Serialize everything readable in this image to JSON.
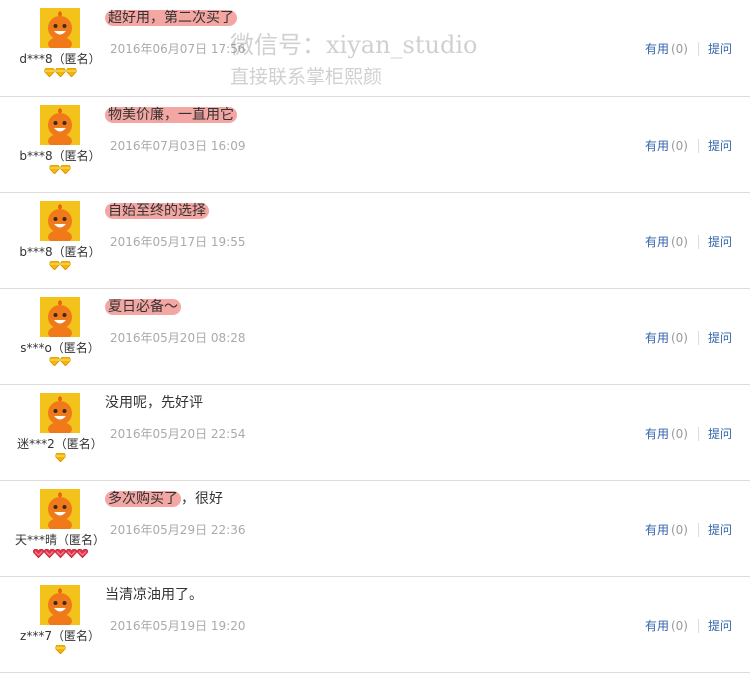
{
  "colors": {
    "highlight": "#f3a6a2",
    "link": "#3366aa",
    "date": "#aaaaaa",
    "divider": "#dddddd",
    "avatar_bg": "#f3c21b"
  },
  "watermark": {
    "line1": "微信号：xiyan_studio",
    "line2": "直接联系掌柜熙颜"
  },
  "reviews": [
    {
      "nick": "d***8（匿名）",
      "gems": 3,
      "gem_type": "gold-diamond",
      "text": "超好用，第二次买了",
      "text_tail": "",
      "highlighted": true,
      "date": "2016年06月07日 17:56",
      "useful_label": "有用",
      "useful_count": "(0)",
      "ask_label": "提问"
    },
    {
      "nick": "b***8（匿名）",
      "gems": 2,
      "gem_type": "gold-diamond",
      "text": "物美价廉，一直用它",
      "text_tail": "",
      "highlighted": true,
      "date": "2016年07月03日 16:09",
      "useful_label": "有用",
      "useful_count": "(0)",
      "ask_label": "提问"
    },
    {
      "nick": "b***8（匿名）",
      "gems": 2,
      "gem_type": "gold-diamond",
      "text": "自始至终的选择",
      "text_tail": "",
      "highlighted": true,
      "date": "2016年05月17日 19:55",
      "useful_label": "有用",
      "useful_count": "(0)",
      "ask_label": "提问"
    },
    {
      "nick": "s***o（匿名）",
      "gems": 2,
      "gem_type": "gold-diamond",
      "text": "夏日必备～",
      "text_tail": "",
      "highlighted": true,
      "date": "2016年05月20日 08:28",
      "useful_label": "有用",
      "useful_count": "(0)",
      "ask_label": "提问"
    },
    {
      "nick": "迷***2（匿名）",
      "gems": 1,
      "gem_type": "gold-diamond",
      "text": "没用呢，先好评",
      "text_tail": "",
      "highlighted": false,
      "date": "2016年05月20日 22:54",
      "useful_label": "有用",
      "useful_count": "(0)",
      "ask_label": "提问"
    },
    {
      "nick": "天***晴（匿名）",
      "gems": 5,
      "gem_type": "red-heart",
      "text": "多次购买了",
      "text_tail": "，很好",
      "highlighted": true,
      "date": "2016年05月29日 22:36",
      "useful_label": "有用",
      "useful_count": "(0)",
      "ask_label": "提问"
    },
    {
      "nick": "z***7（匿名）",
      "gems": 1,
      "gem_type": "gold-diamond",
      "text": "当清凉油用了。",
      "text_tail": "",
      "highlighted": false,
      "date": "2016年05月19日 19:20",
      "useful_label": "有用",
      "useful_count": "(0)",
      "ask_label": "提问"
    }
  ]
}
